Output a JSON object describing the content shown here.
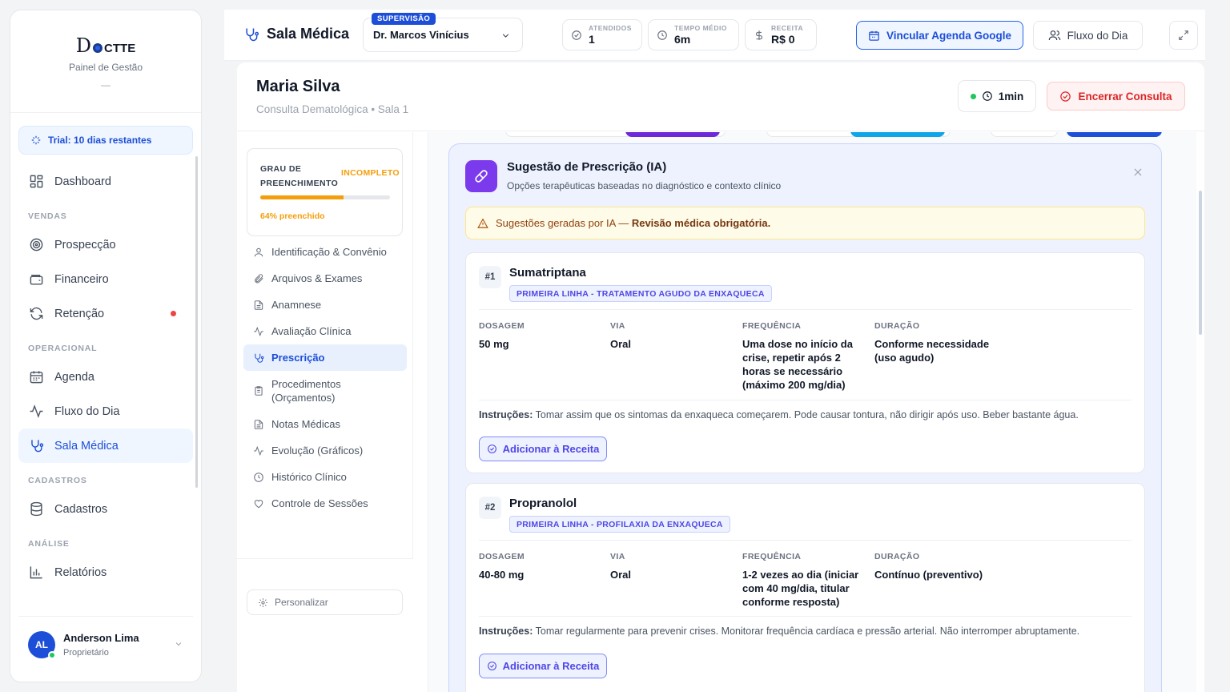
{
  "sidebar": {
    "logo": {
      "d": "D",
      "ctte": "CTTE"
    },
    "subtitle": "Painel de Gestão",
    "dash": "—",
    "trial": "Trial: 10 dias restantes",
    "items": [
      {
        "label": "Dashboard"
      },
      {
        "section": "VENDAS"
      },
      {
        "label": "Prospecção"
      },
      {
        "label": "Financeiro"
      },
      {
        "label": "Retenção"
      },
      {
        "section": "OPERACIONAL"
      },
      {
        "label": "Agenda"
      },
      {
        "label": "Fluxo do Dia"
      },
      {
        "label": "Sala Médica"
      },
      {
        "section": "CADASTROS"
      },
      {
        "label": "Cadastros"
      },
      {
        "section": "ANÁLISE"
      },
      {
        "label": "Relatórios"
      }
    ],
    "user": {
      "initials": "AL",
      "name": "Anderson Lima",
      "role": "Proprietário"
    }
  },
  "topbar": {
    "title": "Sala Médica",
    "supervision_badge": "SUPERVISÃO",
    "doctor": "Dr. Marcos Vinícius",
    "stats": [
      {
        "label": "ATENDIDOS",
        "value": "1"
      },
      {
        "label": "TEMPO MÉDIO",
        "value": "6m"
      },
      {
        "label": "RECEITA",
        "value": "R$ 0"
      }
    ],
    "google_button": "Vincular Agenda Google",
    "flow_button": "Fluxo do Dia"
  },
  "patient": {
    "name": "Maria Silva",
    "subtitle": "Consulta Dematológica • Sala 1",
    "timer": "1min",
    "end_button": "Encerrar Consulta"
  },
  "completion": {
    "title": "GRAU DE PREENCHIMENTO",
    "status": "INCOMPLETO",
    "percent": 64,
    "label": "64% preenchido"
  },
  "sections": [
    {
      "label": "Identificação & Convênio"
    },
    {
      "label": "Arquivos & Exames"
    },
    {
      "label": "Anamnese"
    },
    {
      "label": "Avaliação Clínica"
    },
    {
      "label": "Prescrição"
    },
    {
      "label": "Procedimentos (Orçamentos)"
    },
    {
      "label": "Notas Médicas"
    },
    {
      "label": "Evolução (Gráficos)"
    },
    {
      "label": "Histórico Clínico"
    },
    {
      "label": "Controle de Sessões"
    }
  ],
  "personalize": "Personalizar",
  "ai": {
    "title": "Sugestão de Prescrição (IA)",
    "subtitle": "Opções terapêuticas baseadas no diagnóstico e contexto clínico",
    "warning_prefix": "Sugestões geradas por IA — ",
    "warning_strong": "Revisão médica obrigatória.",
    "col_labels": {
      "dose": "DOSAGEM",
      "route": "VIA",
      "freq": "FREQUÊNCIA",
      "duration": "DURAÇÃO"
    },
    "instructions_label": "Instruções:",
    "add_button": "Adicionar à Receita",
    "meds": [
      {
        "num": "#1",
        "name": "Sumatriptana",
        "badge": "PRIMEIRA LINHA - TRATAMENTO AGUDO DA ENXAQUECA",
        "dose": "50 mg",
        "route": "Oral",
        "freq": "Uma dose no início da crise, repetir após 2 horas se necessário (máximo 200 mg/dia)",
        "duration": "Conforme necessidade (uso agudo)",
        "instructions": "Tomar assim que os sintomas da enxaqueca começarem. Pode causar tontura, não dirigir após uso. Beber bastante água."
      },
      {
        "num": "#2",
        "name": "Propranolol",
        "badge": "PRIMEIRA LINHA - PROFILAXIA DA ENXAQUECA",
        "dose": "40-80 mg",
        "route": "Oral",
        "freq": "1-2 vezes ao dia (iniciar com 40 mg/dia, titular conforme resposta)",
        "duration": "Contínuo (preventivo)",
        "instructions": "Tomar regularmente para prevenir crises. Monitorar frequência cardíaca e pressão arterial. Não interromper abruptamente."
      }
    ]
  },
  "colors": {
    "primary": "#1d4ed8",
    "accent": "#7c3aed",
    "warning": "#f59e0b",
    "danger": "#dc2626"
  }
}
